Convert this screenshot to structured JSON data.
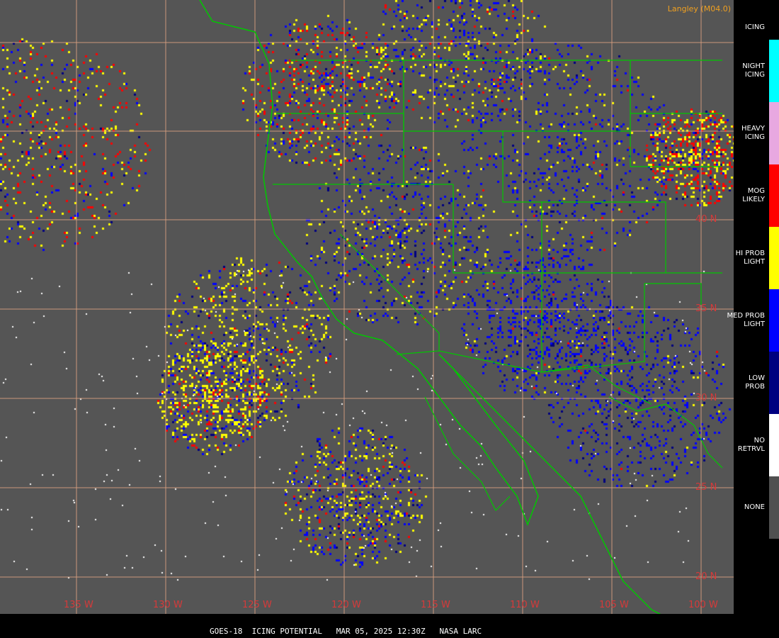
{
  "credit": "Langley (M04.0)",
  "footer": "GOES-18  ICING POTENTIAL   MAR 05, 2025 12:30Z   NASA LARC",
  "legend": {
    "title": "ICING",
    "items": [
      {
        "label": "NIGHT\nICING",
        "color": "#00ffff"
      },
      {
        "label": "HEAVY\nICING",
        "color": "#e8a8e0"
      },
      {
        "label": "MOG\nLIKELY",
        "color": "#ff0000"
      },
      {
        "label": "HI PROB\nLIGHT",
        "color": "#ffff00"
      },
      {
        "label": "MED PROB\nLIGHT",
        "color": "#0000ff"
      },
      {
        "label": "LOW\nPROB",
        "color": "#000080"
      },
      {
        "label": "NO\nRETRVL",
        "color": "#ffffff"
      },
      {
        "label": "NONE",
        "color": "#505050"
      }
    ]
  },
  "latitudes": [
    "40 N",
    "35 N",
    "30 N",
    "25 N",
    "20 N"
  ],
  "longitudes": [
    "135 W",
    "130 W",
    "125 W",
    "120 W",
    "115 W",
    "110 W",
    "105 W",
    "100 W"
  ],
  "colors": {
    "background": "#555555",
    "grid": "#d8a080",
    "coast": "#00c800",
    "state": "#00c800",
    "label": "#d63a3a"
  }
}
